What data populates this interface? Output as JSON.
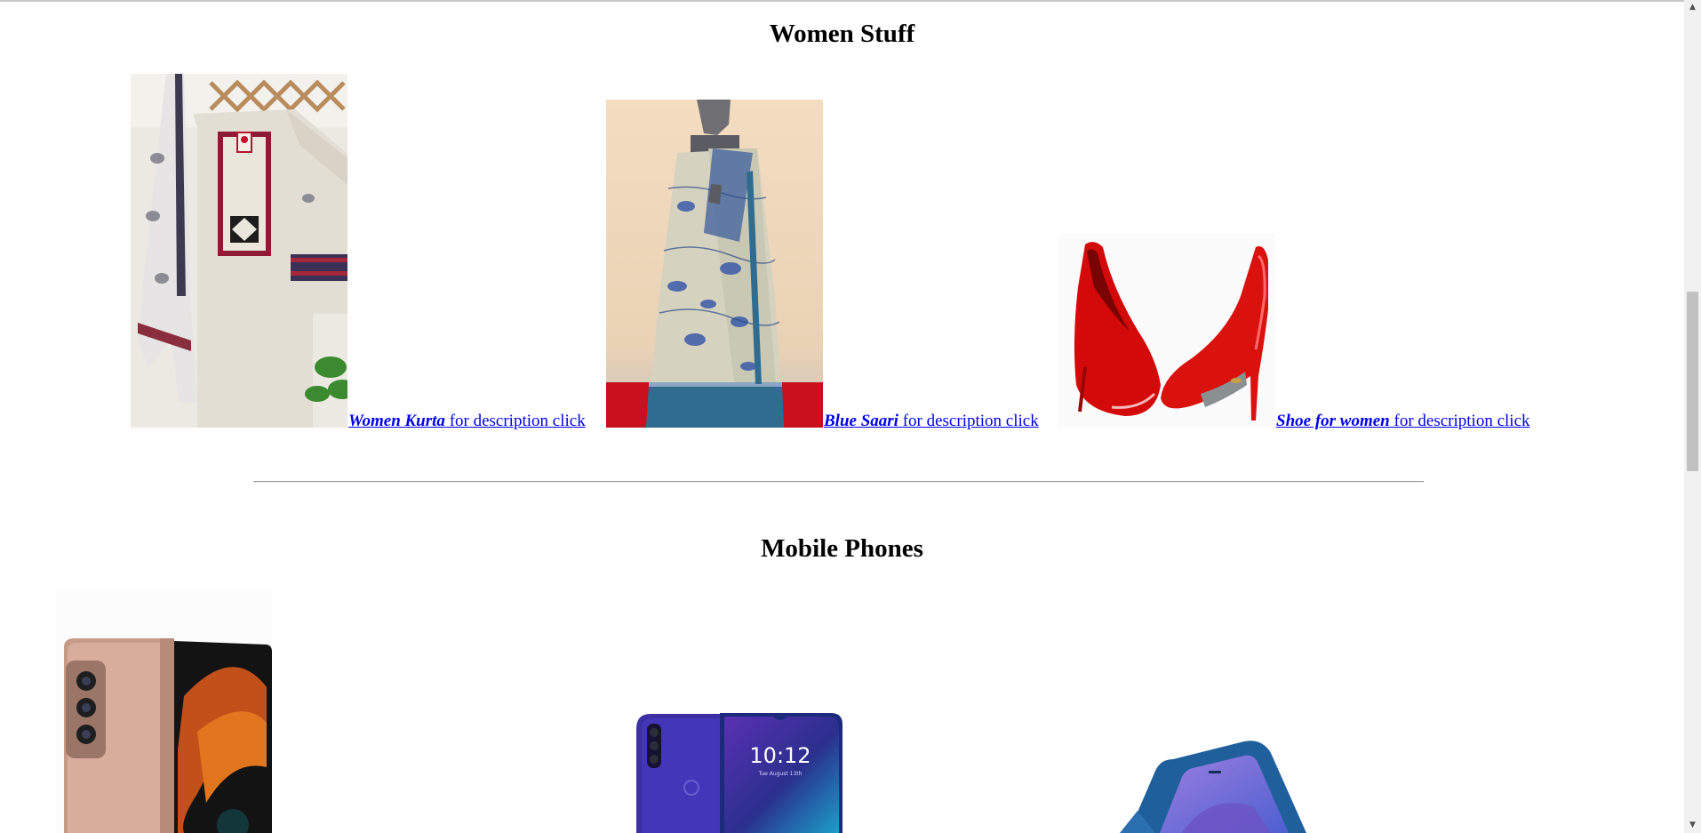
{
  "women_section": {
    "title": "Women Stuff",
    "items": [
      {
        "name": "Women Kurta",
        "suffix": " for description click "
      },
      {
        "name": "Blue Saari",
        "suffix": " for description click "
      },
      {
        "name": "Shoe for women",
        "suffix": " for description click"
      }
    ]
  },
  "mobile_section": {
    "title": "Mobile Phones"
  },
  "scrollbar": {
    "up_icon": "scroll-up-arrow",
    "down_icon": "scroll-down-arrow"
  }
}
